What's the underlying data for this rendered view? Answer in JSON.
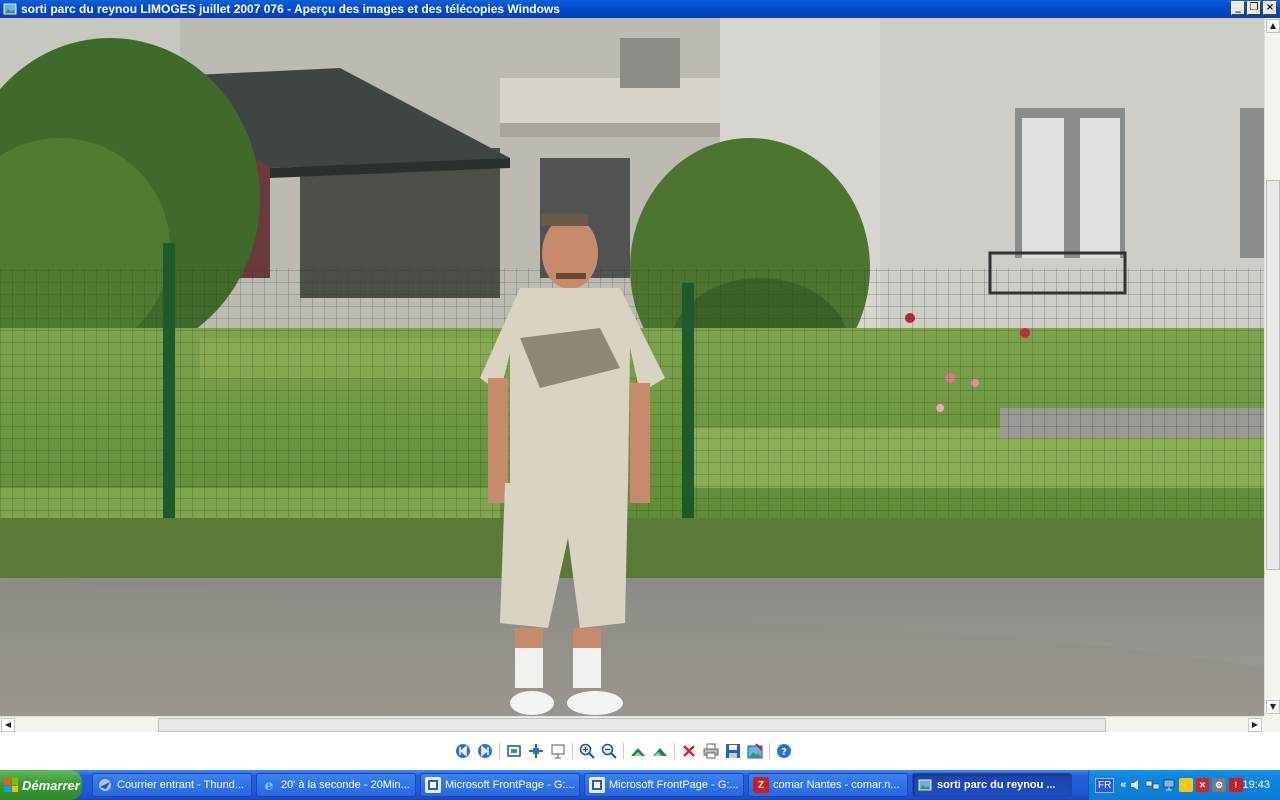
{
  "window": {
    "title": "sorti parc du reynou  LIMOGES  juillet 2007 076 - Aperçu des images et des télécopies Windows",
    "buttons": {
      "minimize": "_",
      "restore": "❐",
      "close": "×"
    }
  },
  "toolbar": {
    "buttons": [
      {
        "name": "previous-image",
        "icon": "previous-icon"
      },
      {
        "name": "next-image",
        "icon": "next-icon"
      },
      {
        "name": "best-fit",
        "icon": "best-fit-icon"
      },
      {
        "name": "actual-size",
        "icon": "actual-size-icon"
      },
      {
        "name": "slideshow",
        "icon": "slideshow-icon"
      },
      {
        "name": "zoom-in",
        "icon": "zoom-in-icon"
      },
      {
        "name": "zoom-out",
        "icon": "zoom-out-icon"
      },
      {
        "name": "rotate-clockwise",
        "icon": "rotate-clockwise-icon"
      },
      {
        "name": "rotate-counterclockwise",
        "icon": "rotate-counterclockwise-icon"
      },
      {
        "name": "delete",
        "icon": "delete-icon"
      },
      {
        "name": "print",
        "icon": "print-icon"
      },
      {
        "name": "copy-to",
        "icon": "save-icon"
      },
      {
        "name": "open-for-editing",
        "icon": "edit-icon"
      },
      {
        "name": "help",
        "icon": "help-icon"
      }
    ]
  },
  "taskbar": {
    "start_label": "Démarrer",
    "tasks": [
      {
        "label": "Courrier entrant - Thund...",
        "icon": "thunderbird-icon",
        "active": false
      },
      {
        "label": "20' à la seconde - 20Min...",
        "icon": "internet-explorer-icon",
        "active": false
      },
      {
        "label": "Microsoft FrontPage - G:...",
        "icon": "frontpage-icon",
        "active": false
      },
      {
        "label": "Microsoft FrontPage - G:...",
        "icon": "frontpage-icon",
        "active": false
      },
      {
        "label": "comar Nantes - comar.n...",
        "icon": "filezilla-icon",
        "active": false
      },
      {
        "label": "sorti parc du reynou ...",
        "icon": "image-viewer-icon",
        "active": true
      }
    ],
    "tray": {
      "language": "FR",
      "chevron": "«",
      "clock": "19:43"
    }
  },
  "colors": {
    "titlebar": "#0047c7",
    "taskbar": "#245edb",
    "start": "#3c9a36",
    "tray": "#0e86e0"
  }
}
